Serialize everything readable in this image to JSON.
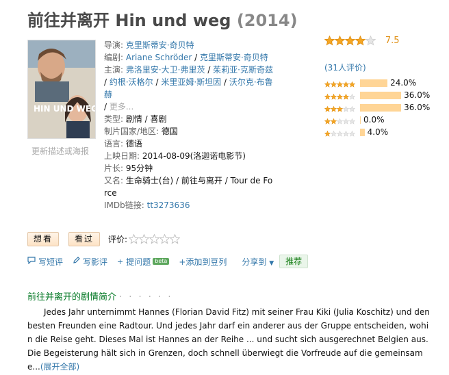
{
  "title": {
    "name": "前往并离开 Hin und weg",
    "year": "(2014)"
  },
  "poster": {
    "title_text": "HIN UND WEG"
  },
  "update_link": "更新描述或海报",
  "info": {
    "director_label": "导演: ",
    "director": "克里斯蒂安·奇贝特",
    "writer_label": "编剧: ",
    "writers": [
      "Ariane Schröder",
      "克里斯蒂安·奇贝特"
    ],
    "cast_label": "主演: ",
    "cast": [
      "弗洛里安·大卫·弗里茨",
      "茱莉亚·克斯奇兹",
      "约根·沃格尔",
      "米里亚姆·斯坦因",
      "沃尔克·布鲁赫"
    ],
    "more": "更多...",
    "genre_label": "类型: ",
    "genre": "剧情 / 喜剧",
    "country_label": "制片国家/地区: ",
    "country": "德国",
    "language_label": "语言: ",
    "language": "德语",
    "release_label": "上映日期: ",
    "release": "2014-08-09(洛迦诺电影节)",
    "runtime_label": "片长: ",
    "runtime": "95分钟",
    "aka_label": "又名: ",
    "aka": "生命骑士(台) / 前往与离开 / Tour de Force",
    "imdb_label": "IMDb链接: ",
    "imdb": "tt3273636"
  },
  "rating": {
    "score": "7.5",
    "stars_value": 4,
    "people": "(31人评价)",
    "distribution": [
      {
        "stars": 5,
        "percent": 24.0,
        "label": "24.0%"
      },
      {
        "stars": 4,
        "percent": 36.0,
        "label": "36.0%"
      },
      {
        "stars": 3,
        "percent": 36.0,
        "label": "36.0%"
      },
      {
        "stars": 2,
        "percent": 0.0,
        "label": "0.0%"
      },
      {
        "stars": 1,
        "percent": 4.0,
        "label": "4.0%"
      }
    ]
  },
  "actions": {
    "want": "想看",
    "seen": "看过",
    "rate_label": "评价:"
  },
  "toolbar": {
    "short_review": "写短评",
    "review": "写影评",
    "ask": "提问题",
    "beta": "beta",
    "add_doulist": "+添加到豆列",
    "share": "分享到",
    "recommend": "推荐"
  },
  "summary": {
    "title": "前往并离开的剧情简介",
    "dots": "· · · · · ·",
    "text": "Jedes Jahr unternimmt Hannes (Florian David Fitz) mit seiner Frau Kiki (Julia Koschitz) und den besten Freunden eine Radtour. Und jedes Jahr darf ein anderer aus der Gruppe entscheiden, wohin die Reise geht. Dieses Mal ist Hannes an der Reihe ... und sucht sich ausgerechnet Belgien aus. Die Begeisterung hält sich in Grenzen, doch schnell überwiegt die Vorfreude auf die gemeinsame...",
    "expand": "(展开全部)"
  },
  "colors": {
    "accent_link": "#3377aa",
    "star": "#f5a623",
    "bar": "#ffd596",
    "green": "#007722"
  }
}
